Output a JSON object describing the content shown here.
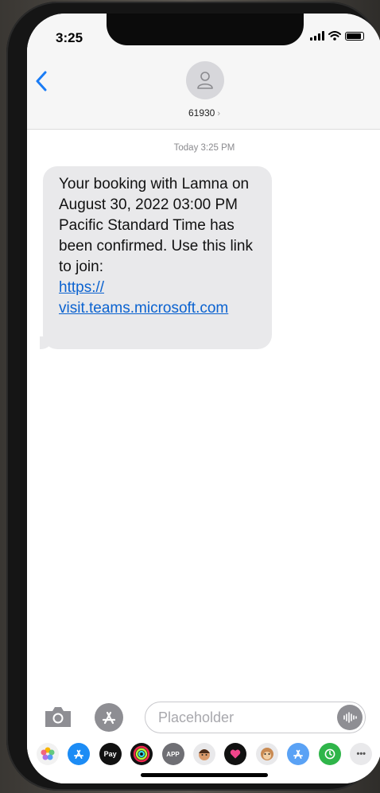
{
  "status": {
    "time": "3:25"
  },
  "header": {
    "back_icon": "chevron-left-icon",
    "contact_name": "61930",
    "contact_chevron": "›"
  },
  "conversation": {
    "timestamp": "Today 3:25 PM",
    "message": {
      "text": "Your booking with Lamna on August 30, 2022 03:00 PM Pacific Standard Time has been confirmed. Use this link to join:",
      "link_line1": "https://",
      "link_line2": "visit.teams.microsoft.com"
    }
  },
  "composer": {
    "placeholder": "Placeholder"
  },
  "app_tray": {
    "items": [
      "photos",
      "app-store",
      "apple-pay",
      "fitness",
      "app",
      "memoji",
      "digital-touch",
      "animoji",
      "app-store-2",
      "find-my",
      "more"
    ],
    "apple_pay_label": "Pay",
    "app_label": "APP",
    "more_label": "•••"
  },
  "colors": {
    "accent": "#1a7cf5",
    "bubble": "#e9e9eb",
    "link": "#0a62d0"
  }
}
